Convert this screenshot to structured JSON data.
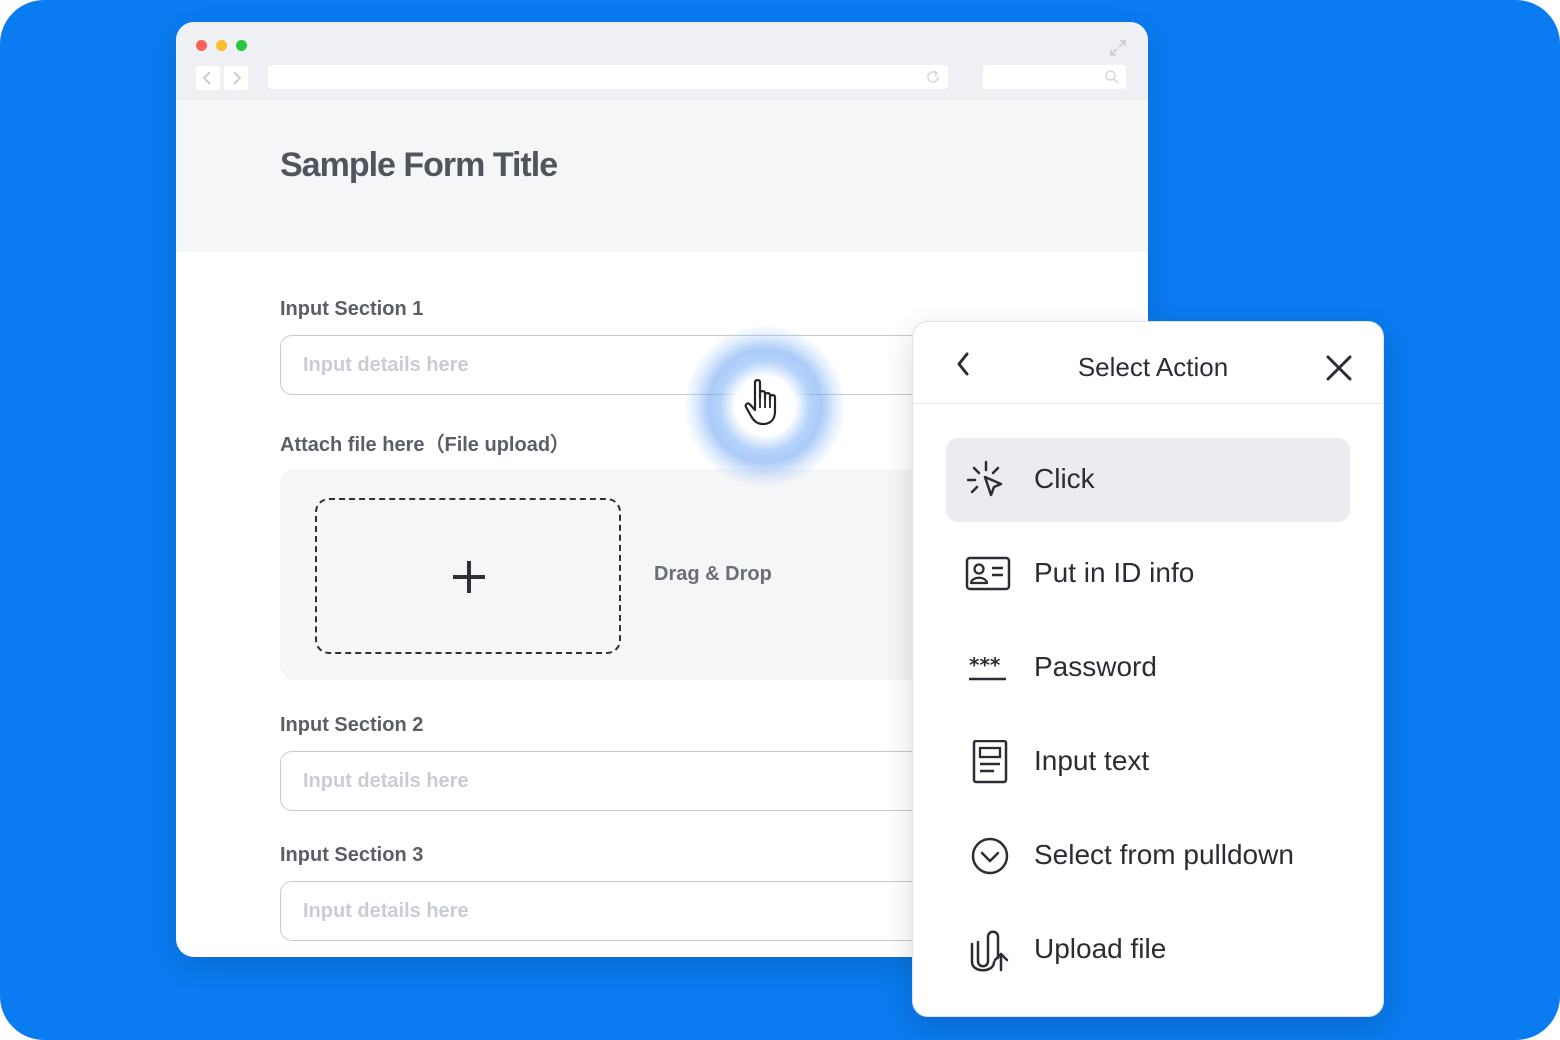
{
  "colors": {
    "background": "#0a7bf0",
    "traffic_red": "#ff5f57",
    "traffic_yellow": "#febc2e",
    "traffic_green": "#28c840",
    "active_item": "#eaecef"
  },
  "form": {
    "title": "Sample Form Title",
    "section1_label": "Input Section 1",
    "section1_placeholder": "Input details here",
    "upload_label": "Attach file here（File upload）",
    "drag_drop": "Drag & Drop",
    "section2_label": "Input Section 2",
    "section2_placeholder": "Input details here",
    "section3_label": "Input Section 3",
    "section3_placeholder": "Input details here"
  },
  "panel": {
    "title": "Select Action",
    "items": [
      {
        "label": "Click",
        "icon": "click-cursor-icon",
        "active": true
      },
      {
        "label": "Put in ID info",
        "icon": "id-card-icon",
        "active": false
      },
      {
        "label": "Password",
        "icon": "password-icon",
        "active": false
      },
      {
        "label": "Input text",
        "icon": "document-icon",
        "active": false
      },
      {
        "label": "Select from pulldown",
        "icon": "chevron-circle-icon",
        "active": false
      },
      {
        "label": "Upload file",
        "icon": "paperclip-upload-icon",
        "active": false
      }
    ]
  }
}
